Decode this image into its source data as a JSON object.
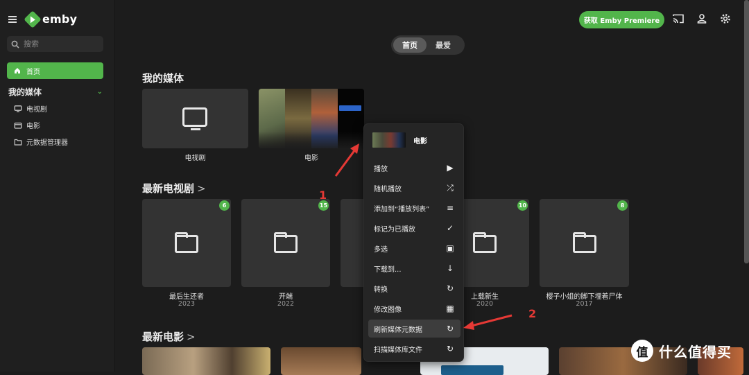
{
  "app": {
    "logo_text": "emby"
  },
  "sidebar": {
    "search_placeholder": "搜索",
    "home_label": "首页",
    "section_title": "我的媒体",
    "items": [
      {
        "label": "电视剧",
        "icon": "tv-icon"
      },
      {
        "label": "电影",
        "icon": "film-icon"
      },
      {
        "label": "元数据管理器",
        "icon": "folder-icon"
      }
    ]
  },
  "header": {
    "premiere_button": "获取 Emby Premiere",
    "icons": [
      "cast-icon",
      "user-icon",
      "settings-icon"
    ]
  },
  "tabs": [
    {
      "label": "首页",
      "active": true
    },
    {
      "label": "最爱",
      "active": false
    }
  ],
  "my_media": {
    "title": "我的媒体",
    "libraries": [
      {
        "label": "电视剧"
      },
      {
        "label": "电影"
      }
    ]
  },
  "latest_tv": {
    "title": "最新电视剧",
    "items": [
      {
        "title": "最后生还者",
        "year": "2023",
        "badge": "6"
      },
      {
        "title": "开端",
        "year": "2022",
        "badge": "15"
      },
      {
        "title": "",
        "year": "",
        "badge": ""
      },
      {
        "title": "上载新生",
        "year": "2020",
        "badge": "10"
      },
      {
        "title": "樱子小姐的脚下埋着尸体",
        "year": "2017",
        "badge": "8"
      }
    ]
  },
  "latest_movies": {
    "title": "最新电影"
  },
  "context_menu": {
    "header_title": "电影",
    "items": [
      {
        "label": "播放",
        "icon": "play-icon"
      },
      {
        "label": "随机播放",
        "icon": "shuffle-icon"
      },
      {
        "label": "添加到“播放列表”",
        "icon": "playlist-add-icon"
      },
      {
        "label": "标记为已播放",
        "icon": "check-icon"
      },
      {
        "label": "多选",
        "icon": "select-all-icon"
      },
      {
        "label": "下载到...",
        "icon": "download-icon"
      },
      {
        "label": "转换",
        "icon": "convert-icon"
      },
      {
        "label": "修改图像",
        "icon": "image-icon"
      },
      {
        "label": "刷新媒体元数据",
        "icon": "refresh-icon",
        "highlighted": true
      },
      {
        "label": "扫描媒体库文件",
        "icon": "refresh-icon"
      }
    ]
  },
  "annotations": {
    "step1": "1",
    "step2": "2"
  },
  "watermark": {
    "circle": "值",
    "text": "什么值得买"
  },
  "colors": {
    "accent": "#52b54b",
    "background": "#1c1c1c",
    "card": "#333333",
    "annotation": "#e53935"
  }
}
